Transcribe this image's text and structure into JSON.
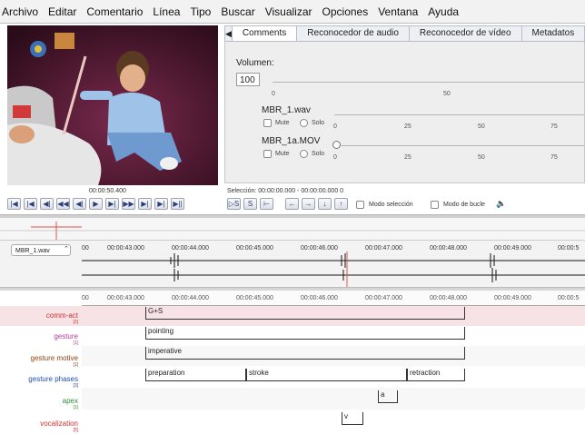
{
  "menu": [
    "Archivo",
    "Editar",
    "Comentario",
    "Línea",
    "Tipo",
    "Buscar",
    "Visualizar",
    "Opciones",
    "Ventana",
    "Ayuda"
  ],
  "tabs": [
    "Comments",
    "Reconocedor de audio",
    "Reconocedor de vídeo",
    "Metadatos"
  ],
  "tab_arrow": "◀",
  "audio": {
    "volume_label": "Volumen:",
    "volume_value": "100",
    "master_ticks": [
      "0",
      "50"
    ],
    "tracks": [
      {
        "name": "MBR_1.wav",
        "mute": "Mute",
        "solo": "Solo",
        "ticks": [
          "0",
          "25",
          "50",
          "75"
        ]
      },
      {
        "name": "MBR_1a.MOV",
        "mute": "Mute",
        "solo": "Solo",
        "ticks": [
          "0",
          "25",
          "50",
          "75"
        ]
      }
    ]
  },
  "transport": {
    "current_time": "00:00:50.400",
    "selection": "Selección: 00:00:00.000 - 00:00:00.000  0",
    "media_buttons": [
      "|◀",
      "|◀",
      "◀|",
      "◀◀",
      "◀|",
      "▶",
      "▶|",
      "▶▶",
      "▶|",
      "▶|",
      "▶||"
    ],
    "edit_buttons": [
      "▷S",
      "S",
      "⊢",
      "←",
      "→",
      "↓",
      "↑"
    ],
    "mode_selection": "Modo selección",
    "loop_mode": "Modo de bucle",
    "speaker": "🔈"
  },
  "waveform": {
    "file": "MBR_1.wav",
    "time_labels": [
      "00",
      "00:00:43.000",
      "00:00:44.000",
      "00:00:45.000",
      "00:00:46.000",
      "00:00:47.000",
      "00:00:48.000",
      "00:00:49.000",
      "00:00:5"
    ]
  },
  "timeline": {
    "time_labels": [
      "00",
      "00:00:43.000",
      "00:00:44.000",
      "00:00:45.000",
      "00:00:46.000",
      "00:00:47.000",
      "00:00:48.000",
      "00:00:49.000",
      "00:00:5"
    ],
    "tiers": [
      {
        "name": "comm-act",
        "count": "[2]",
        "color": "#d0302f"
      },
      {
        "name": "gesture",
        "count": "[1]",
        "color": "#b03f9a"
      },
      {
        "name": "gesture motive",
        "count": "[1]",
        "color": "#8b4513"
      },
      {
        "name": "gesture phases",
        "count": "[3]",
        "color": "#1f4ea8"
      },
      {
        "name": "apex",
        "count": "[1]",
        "color": "#2e8b3a"
      },
      {
        "name": "vocalization",
        "count": "[5]",
        "color": "#d0302f"
      }
    ],
    "annotations": {
      "comm_act": "G+S",
      "gesture": "pointing",
      "gesture_motive": "imperative",
      "phase_1": "preparation",
      "phase_2": "stroke",
      "phase_3": "retraction",
      "apex": "a",
      "vocalization": "v"
    }
  },
  "colors": {
    "comm_act_row": "#f7e3e6",
    "crosshair": "#e05050",
    "accent_blue": "#2a3f7a"
  }
}
